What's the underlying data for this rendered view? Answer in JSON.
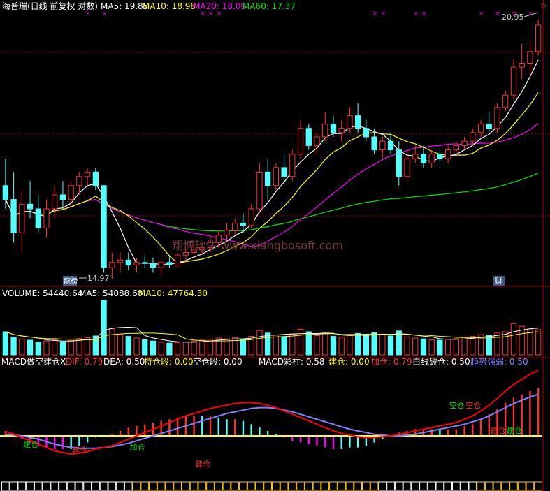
{
  "header": {
    "title": "海普瑞(日线 前复权 对数)",
    "ma5": "MA5: 19.85",
    "ma10": "MA10: 18.98",
    "ma20": "MA20: 18.09",
    "ma60": "MA60: 17.37"
  },
  "price_marks": {
    "high": "20.95",
    "low": "14.97"
  },
  "badges": {
    "left": "龍榜",
    "right": "财"
  },
  "watermark": "翔博软件 www.xiangbosoft.com",
  "volume_header": {
    "volume": "VOLUME: 54440.64",
    "ma5": "MA5: 54088.60",
    "ma10": "MA10: 47764.30"
  },
  "macd_header": {
    "name": "MACD做空建仓X",
    "dif": "DIF: 0.79",
    "dea": "DEA: 0.50",
    "hold": "持仓段: 0.00",
    "short": "空仓段: 0.00",
    "bar": "MACD彩柱: 0.58",
    "build": "建仓: 0.00",
    "add": "加仓: 0.79",
    "break": "白线破仓: 0.50",
    "trend": "趋势强弱: 0.50"
  },
  "signal_labels": [
    "建仓",
    "建仓",
    "加仓",
    "建仓",
    "空仓",
    "空仓",
    "建仓",
    "建仓"
  ],
  "colors": {
    "bg": "#000000",
    "up": "#ff3232",
    "down": "#54ffff",
    "ma5": "#ffffff",
    "ma10": "#ffff00",
    "ma20": "#ff00ff",
    "ma60": "#00e600",
    "dif": "#ff0000",
    "dea": "#8080ff",
    "white": "#ffffff",
    "yellow": "#ffff00",
    "grid": "#aa0000"
  },
  "chart_data": {
    "type": "candlestick",
    "price_axis": "log",
    "candles": [
      {
        "o": 16.9,
        "h": 17.5,
        "l": 16.4,
        "c": 16.6
      },
      {
        "o": 16.6,
        "h": 17.2,
        "l": 15.7,
        "c": 15.9
      },
      {
        "o": 15.9,
        "h": 16.8,
        "l": 15.5,
        "c": 16.5
      },
      {
        "o": 16.5,
        "h": 17.0,
        "l": 16.2,
        "c": 16.4
      },
      {
        "o": 16.4,
        "h": 16.7,
        "l": 15.9,
        "c": 16.0
      },
      {
        "o": 16.0,
        "h": 16.6,
        "l": 15.8,
        "c": 16.4
      },
      {
        "o": 16.4,
        "h": 16.9,
        "l": 16.2,
        "c": 16.7
      },
      {
        "o": 16.7,
        "h": 17.0,
        "l": 16.4,
        "c": 16.6
      },
      {
        "o": 16.6,
        "h": 17.0,
        "l": 16.5,
        "c": 16.9
      },
      {
        "o": 16.9,
        "h": 17.2,
        "l": 16.7,
        "c": 17.1
      },
      {
        "o": 17.1,
        "h": 17.3,
        "l": 16.9,
        "c": 17.2
      },
      {
        "o": 17.2,
        "h": 17.3,
        "l": 16.8,
        "c": 16.9
      },
      {
        "o": 16.9,
        "h": 16.9,
        "l": 15.1,
        "c": 15.2
      },
      {
        "o": 15.2,
        "h": 15.5,
        "l": 14.97,
        "c": 15.3
      },
      {
        "o": 15.3,
        "h": 15.5,
        "l": 15.1,
        "c": 15.35
      },
      {
        "o": 15.35,
        "h": 15.5,
        "l": 15.15,
        "c": 15.25
      },
      {
        "o": 15.25,
        "h": 15.4,
        "l": 15.1,
        "c": 15.3
      },
      {
        "o": 15.3,
        "h": 15.45,
        "l": 15.2,
        "c": 15.28
      },
      {
        "o": 15.28,
        "h": 15.4,
        "l": 15.1,
        "c": 15.2
      },
      {
        "o": 15.2,
        "h": 15.35,
        "l": 15.05,
        "c": 15.3
      },
      {
        "o": 15.3,
        "h": 15.45,
        "l": 15.2,
        "c": 15.25
      },
      {
        "o": 15.25,
        "h": 15.5,
        "l": 15.2,
        "c": 15.45
      },
      {
        "o": 15.45,
        "h": 15.6,
        "l": 15.3,
        "c": 15.5
      },
      {
        "o": 15.5,
        "h": 15.65,
        "l": 15.4,
        "c": 15.55
      },
      {
        "o": 15.55,
        "h": 15.7,
        "l": 15.45,
        "c": 15.6
      },
      {
        "o": 15.6,
        "h": 15.8,
        "l": 15.5,
        "c": 15.7
      },
      {
        "o": 15.7,
        "h": 15.95,
        "l": 15.6,
        "c": 15.85
      },
      {
        "o": 15.85,
        "h": 16.1,
        "l": 15.75,
        "c": 15.95
      },
      {
        "o": 15.95,
        "h": 16.2,
        "l": 15.85,
        "c": 16.1
      },
      {
        "o": 16.1,
        "h": 16.3,
        "l": 15.9,
        "c": 16.05
      },
      {
        "o": 16.05,
        "h": 16.5,
        "l": 16.0,
        "c": 16.4
      },
      {
        "o": 16.4,
        "h": 17.4,
        "l": 16.3,
        "c": 17.2
      },
      {
        "o": 17.2,
        "h": 17.5,
        "l": 16.6,
        "c": 16.9
      },
      {
        "o": 16.9,
        "h": 17.4,
        "l": 16.8,
        "c": 17.3
      },
      {
        "o": 17.3,
        "h": 17.6,
        "l": 17.0,
        "c": 17.1
      },
      {
        "o": 17.1,
        "h": 17.7,
        "l": 17.0,
        "c": 17.6
      },
      {
        "o": 17.6,
        "h": 18.4,
        "l": 17.5,
        "c": 18.2
      },
      {
        "o": 18.2,
        "h": 18.3,
        "l": 17.7,
        "c": 17.8
      },
      {
        "o": 17.8,
        "h": 18.1,
        "l": 17.6,
        "c": 18.0
      },
      {
        "o": 18.0,
        "h": 18.6,
        "l": 17.9,
        "c": 18.3
      },
      {
        "o": 18.3,
        "h": 18.5,
        "l": 18.0,
        "c": 18.1
      },
      {
        "o": 18.1,
        "h": 18.4,
        "l": 17.9,
        "c": 18.2
      },
      {
        "o": 18.2,
        "h": 18.7,
        "l": 18.1,
        "c": 18.5
      },
      {
        "o": 18.5,
        "h": 18.8,
        "l": 18.1,
        "c": 18.2
      },
      {
        "o": 18.2,
        "h": 18.4,
        "l": 17.9,
        "c": 18.0
      },
      {
        "o": 18.0,
        "h": 18.2,
        "l": 17.6,
        "c": 17.7
      },
      {
        "o": 17.7,
        "h": 18.0,
        "l": 17.5,
        "c": 17.9
      },
      {
        "o": 17.9,
        "h": 18.1,
        "l": 17.6,
        "c": 17.7
      },
      {
        "o": 17.7,
        "h": 17.9,
        "l": 16.9,
        "c": 17.1
      },
      {
        "o": 17.1,
        "h": 17.6,
        "l": 17.0,
        "c": 17.5
      },
      {
        "o": 17.5,
        "h": 17.8,
        "l": 17.4,
        "c": 17.6
      },
      {
        "o": 17.6,
        "h": 17.8,
        "l": 17.3,
        "c": 17.4
      },
      {
        "o": 17.4,
        "h": 17.7,
        "l": 17.3,
        "c": 17.6
      },
      {
        "o": 17.6,
        "h": 17.7,
        "l": 17.4,
        "c": 17.5
      },
      {
        "o": 17.5,
        "h": 17.8,
        "l": 17.4,
        "c": 17.7
      },
      {
        "o": 17.7,
        "h": 17.9,
        "l": 17.6,
        "c": 17.8
      },
      {
        "o": 17.8,
        "h": 18.0,
        "l": 17.7,
        "c": 17.9
      },
      {
        "o": 17.9,
        "h": 18.2,
        "l": 17.8,
        "c": 18.1
      },
      {
        "o": 18.1,
        "h": 18.4,
        "l": 18.0,
        "c": 18.3
      },
      {
        "o": 18.3,
        "h": 18.6,
        "l": 18.1,
        "c": 18.2
      },
      {
        "o": 18.2,
        "h": 18.8,
        "l": 18.1,
        "c": 18.7
      },
      {
        "o": 18.7,
        "h": 19.1,
        "l": 18.6,
        "c": 19.0
      },
      {
        "o": 19.0,
        "h": 19.9,
        "l": 18.9,
        "c": 19.7
      },
      {
        "o": 19.7,
        "h": 20.3,
        "l": 19.4,
        "c": 19.8
      },
      {
        "o": 19.8,
        "h": 20.4,
        "l": 19.5,
        "c": 20.1
      },
      {
        "o": 20.1,
        "h": 20.95,
        "l": 20.0,
        "c": 20.8
      }
    ],
    "volume": [
      55,
      42,
      38,
      35,
      30,
      33,
      36,
      31,
      34,
      39,
      41,
      45,
      130,
      62,
      48,
      44,
      40,
      36,
      33,
      30,
      28,
      29,
      31,
      33,
      35,
      37,
      40,
      38,
      41,
      36,
      44,
      58,
      52,
      47,
      43,
      49,
      61,
      55,
      46,
      50,
      44,
      42,
      48,
      51,
      46,
      53,
      49,
      45,
      57,
      43,
      40,
      38,
      36,
      35,
      37,
      39,
      42,
      44,
      48,
      46,
      52,
      55,
      74,
      68,
      62,
      60
    ],
    "volume_ma5": "MA5: 54088.60",
    "volume_ma10": "MA10: 47764.30",
    "macd": {
      "dif": [
        0.05,
        0.02,
        -0.02,
        -0.06,
        -0.1,
        -0.14,
        -0.18,
        -0.2,
        -0.22,
        -0.21,
        -0.19,
        -0.16,
        -0.14,
        -0.12,
        -0.08,
        -0.04,
        0.0,
        0.04,
        0.08,
        0.12,
        0.16,
        0.2,
        0.24,
        0.27,
        0.3,
        0.33,
        0.35,
        0.37,
        0.39,
        0.4,
        0.4,
        0.39,
        0.37,
        0.34,
        0.3,
        0.26,
        0.22,
        0.18,
        0.14,
        0.1,
        0.06,
        0.03,
        0.01,
        -0.01,
        -0.02,
        -0.02,
        -0.01,
        0.0,
        0.02,
        0.04,
        0.06,
        0.08,
        0.1,
        0.12,
        0.14,
        0.16,
        0.2,
        0.24,
        0.3,
        0.37,
        0.45,
        0.54,
        0.62,
        0.68,
        0.74,
        0.79
      ],
      "dea": [
        0.02,
        0.01,
        0.0,
        -0.02,
        -0.04,
        -0.07,
        -0.1,
        -0.12,
        -0.14,
        -0.15,
        -0.15,
        -0.15,
        -0.14,
        -0.13,
        -0.11,
        -0.09,
        -0.06,
        -0.03,
        0.0,
        0.03,
        0.06,
        0.09,
        0.12,
        0.15,
        0.18,
        0.21,
        0.24,
        0.27,
        0.29,
        0.31,
        0.33,
        0.34,
        0.34,
        0.33,
        0.31,
        0.29,
        0.26,
        0.23,
        0.2,
        0.17,
        0.14,
        0.11,
        0.08,
        0.06,
        0.04,
        0.02,
        0.01,
        0.0,
        0.0,
        0.01,
        0.02,
        0.04,
        0.06,
        0.08,
        0.1,
        0.12,
        0.14,
        0.17,
        0.2,
        0.24,
        0.29,
        0.34,
        0.39,
        0.43,
        0.47,
        0.5
      ],
      "labels": [
        "DIF: 0.79",
        "DEA: 0.50",
        "MACD彩柱: 0.58"
      ]
    },
    "title": "海普瑞(日线 前复权 对数)"
  }
}
